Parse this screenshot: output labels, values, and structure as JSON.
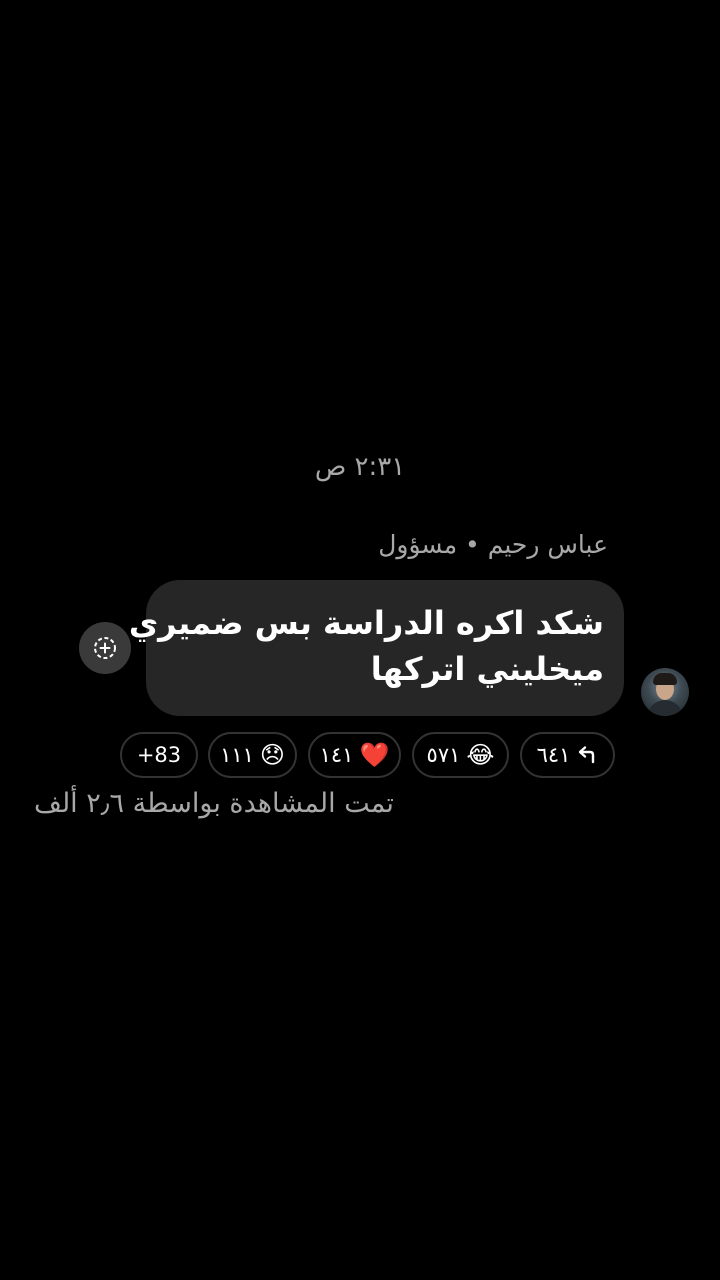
{
  "chat": {
    "timestamp": "٢:٣١ ص",
    "sender": "عباس رحيم • مسؤول",
    "message": {
      "line1": "شكد اكره الدراسة بس ضميري",
      "line2": "ميخليني اتركها"
    },
    "reactions": {
      "replies": {
        "icon": "reply-icon",
        "count": "٦٤١"
      },
      "laugh": {
        "icon": "😂",
        "count": "٥٧١"
      },
      "heart": {
        "icon": "❤️",
        "count": "١٤١"
      },
      "sad": {
        "icon": "😞",
        "count": "١١١"
      },
      "more": {
        "label": "+83"
      }
    },
    "seen_by": "تمت المشاهدة بواسطة ٢٫٦ ألف"
  },
  "colors": {
    "background": "#000000",
    "bubble": "#262626",
    "secondary_text": "#a8a8a8",
    "pill_border": "#333333"
  }
}
